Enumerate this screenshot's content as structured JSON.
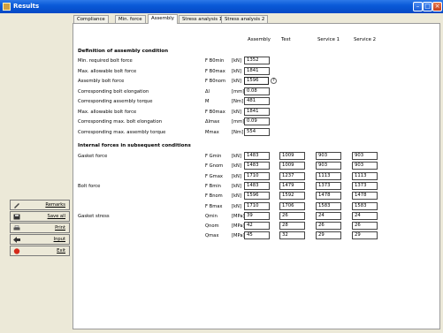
{
  "window": {
    "title": "Results"
  },
  "tabs": [
    "Compliance",
    "Min. force",
    "Assembly",
    "Stress analysis 1",
    "Stress analysis 2"
  ],
  "active_tab": "Assembly",
  "columns": [
    "Assembly",
    "Test",
    "Service 1",
    "Service 2"
  ],
  "section1": {
    "title": "Definition of assembly condition"
  },
  "assembly_rows": [
    {
      "label": "Min. required bolt force",
      "symbol": "F B0min",
      "unit": "[kN]",
      "value": "1352"
    },
    {
      "label": "Max. allowable bolt force",
      "symbol": "F B0max",
      "unit": "[kN]",
      "value": "1841"
    },
    {
      "label": "Assembly bolt force",
      "symbol": "F B0nom",
      "unit": "[kN]",
      "value": "1596"
    },
    {
      "label": "Corresponding bolt elongation",
      "symbol": "Δl",
      "unit": "[mm]",
      "value": "0.08"
    },
    {
      "label": "Corresponding assembly torque",
      "symbol": "M",
      "unit": "[Nm]",
      "value": "481"
    },
    {
      "label": "Max. allowable bolt force",
      "symbol": "F B0max",
      "unit": "[kN]",
      "value": "1841"
    },
    {
      "label": "Corresponding max. bolt elongation",
      "symbol": "Δlmax",
      "unit": "[mm]",
      "value": "0.09"
    },
    {
      "label": "Corresponding max. assembly torque",
      "symbol": "Mmax",
      "unit": "[Nm]",
      "value": "554"
    }
  ],
  "section2": {
    "title": "Internal forces in subsequent conditions"
  },
  "groups": [
    {
      "label": "Gasket force",
      "rows": [
        {
          "symbol": "F Gmin",
          "unit": "[kN]",
          "values": [
            "1483",
            "1009",
            "903",
            "903"
          ]
        },
        {
          "symbol": "F Gnom",
          "unit": "[kN]",
          "values": [
            "1483",
            "1009",
            "903",
            "903"
          ]
        },
        {
          "symbol": "F Gmax",
          "unit": "[kN]",
          "values": [
            "1710",
            "1237",
            "1113",
            "1113"
          ]
        }
      ]
    },
    {
      "label": "Bolt force",
      "rows": [
        {
          "symbol": "F Bmin",
          "unit": "[kN]",
          "values": [
            "1483",
            "1479",
            "1373",
            "1373"
          ]
        },
        {
          "symbol": "F Bnom",
          "unit": "[kN]",
          "values": [
            "1596",
            "1592",
            "1478",
            "1478"
          ]
        },
        {
          "symbol": "F Bmax",
          "unit": "[kN]",
          "values": [
            "1710",
            "1706",
            "1583",
            "1583"
          ]
        }
      ]
    },
    {
      "label": "Gasket stress",
      "rows": [
        {
          "symbol": "Qmin",
          "unit": "[MPa]",
          "values": [
            "39",
            "26",
            "24",
            "24"
          ]
        },
        {
          "symbol": "Qnom",
          "unit": "[MPa]",
          "values": [
            "42",
            "28",
            "26",
            "26"
          ]
        },
        {
          "symbol": "Qmax",
          "unit": "[MPa]",
          "values": [
            "45",
            "32",
            "29",
            "29"
          ]
        }
      ]
    }
  ],
  "side_buttons": [
    {
      "label": "Remarks",
      "icon": "pencil-icon"
    },
    {
      "label": "Save all",
      "icon": "floppy-disk-icon"
    },
    {
      "label": "Print",
      "icon": "printer-icon"
    },
    {
      "label": "Input",
      "icon": "back-arrow-icon"
    },
    {
      "label": "Exit",
      "icon": "stop-icon"
    }
  ],
  "colors": {
    "titlebar": "#0a5ad8",
    "panel": "#ffffff",
    "window_bg": "#ece9d8"
  }
}
